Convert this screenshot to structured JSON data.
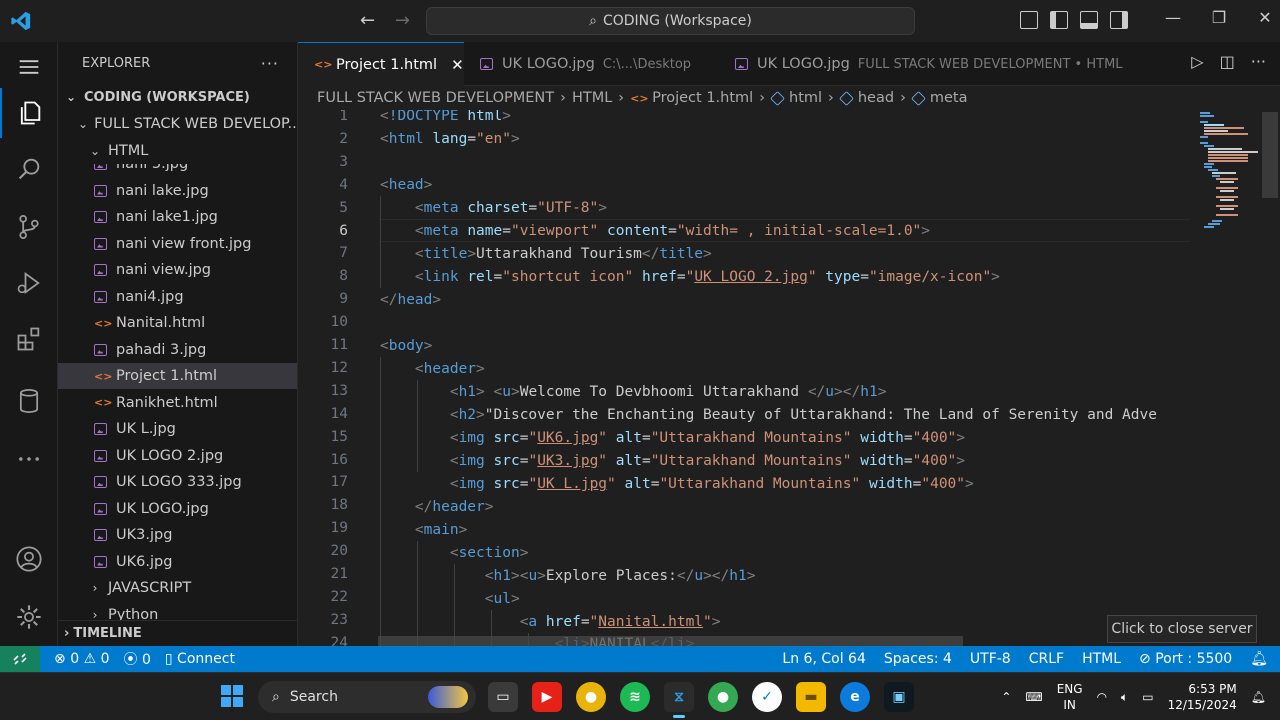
{
  "titlebar": {
    "search_text": "CODING (Workspace)",
    "back_glyph": "←",
    "forward_glyph": "→",
    "minimize_glyph": "—",
    "restore_glyph": "❐",
    "close_glyph": "✕"
  },
  "sidebar": {
    "title": "EXPLORER",
    "more_glyph": "···",
    "workspace": "CODING (WORKSPACE)",
    "project_folder": "FULL STACK WEB DEVELOP...",
    "html_folder": "HTML",
    "files": [
      {
        "name": "nani 3.jpg",
        "type": "img"
      },
      {
        "name": "nani lake.jpg",
        "type": "img"
      },
      {
        "name": "nani lake1.jpg",
        "type": "img"
      },
      {
        "name": "nani view front.jpg",
        "type": "img"
      },
      {
        "name": "nani view.jpg",
        "type": "img"
      },
      {
        "name": "nani4.jpg",
        "type": "img"
      },
      {
        "name": "Nanital.html",
        "type": "html"
      },
      {
        "name": "pahadi 3.jpg",
        "type": "img"
      },
      {
        "name": "Project 1.html",
        "type": "html"
      },
      {
        "name": "Ranikhet.html",
        "type": "html"
      },
      {
        "name": "UK L.jpg",
        "type": "img"
      },
      {
        "name": "UK LOGO 2.jpg",
        "type": "img"
      },
      {
        "name": "UK LOGO 333.jpg",
        "type": "img"
      },
      {
        "name": "UK LOGO.jpg",
        "type": "img"
      },
      {
        "name": "UK3.jpg",
        "type": "img"
      },
      {
        "name": "UK6.jpg",
        "type": "img"
      }
    ],
    "folders_after": [
      "JAVASCRIPT",
      "Python"
    ],
    "timeline": "TIMELINE"
  },
  "tabs": [
    {
      "label": "Project 1.html",
      "desc": "",
      "active": true
    },
    {
      "label": "UK LOGO.jpg",
      "desc": "C:\\...\\Desktop",
      "active": false
    },
    {
      "label": "UK LOGO.jpg",
      "desc": "FULL STACK WEB DEVELOPMENT • HTML",
      "active": false
    }
  ],
  "tab_close_glyph": "✕",
  "breadcrumb": [
    "FULL STACK WEB DEVELOPMENT",
    "HTML",
    "Project 1.html",
    "html",
    "head",
    "meta"
  ],
  "editor": {
    "current_line": 6,
    "line_numbers": [
      "1",
      "2",
      "3",
      "4",
      "5",
      "6",
      "7",
      "8",
      "9",
      "10",
      "11",
      "12",
      "13",
      "14",
      "15",
      "16",
      "17",
      "18",
      "19",
      "20",
      "21",
      "22",
      "23",
      "24"
    ]
  },
  "tooltip": "Click to close server",
  "statusbar": {
    "errors": "0",
    "warnings": "0",
    "ports": "0",
    "connect": "Connect",
    "position": "Ln 6, Col 64",
    "spaces": "Spaces: 4",
    "encoding": "UTF-8",
    "eol": "CRLF",
    "language": "HTML",
    "port": "Port : 5500"
  },
  "taskbar": {
    "search": "Search",
    "lang_line1": "ENG",
    "lang_line2": "IN",
    "time": "6:53 PM",
    "date": "12/15/2024"
  },
  "colors": {
    "accent": "#007acc",
    "tag": "#569cd6",
    "attr": "#9cdcfe",
    "string": "#ce9178"
  }
}
